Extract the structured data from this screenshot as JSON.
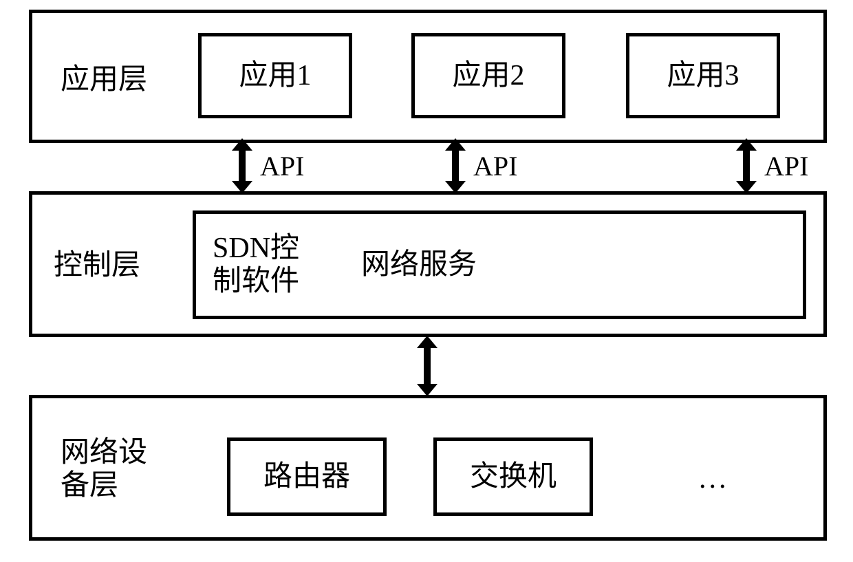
{
  "layers": {
    "application": {
      "title": "应用层",
      "apps": [
        "应用1",
        "应用2",
        "应用3"
      ]
    },
    "control": {
      "title": "控制层",
      "sdn_label": "SDN控\n制软件",
      "network_service": "网络服务"
    },
    "device": {
      "title": "网络设\n备层",
      "router": "路由器",
      "switch": "交换机",
      "ellipsis": "..."
    }
  },
  "interfaces": {
    "api_label": "API"
  }
}
